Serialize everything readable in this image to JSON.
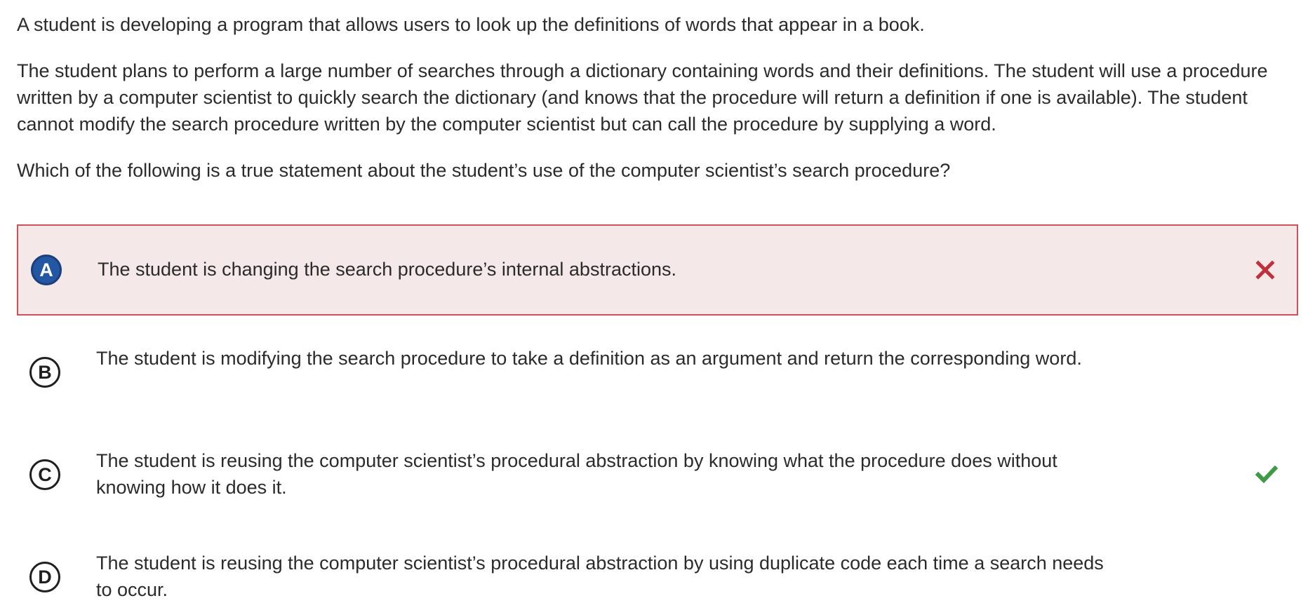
{
  "question": {
    "intro": "A student is developing a program that allows users to look up the definitions of words that appear in a book.",
    "context": "The student plans to perform a large number of searches through a dictionary containing words and their definitions. The student will use a procedure written by a computer scientist to quickly search the dictionary (and knows that the procedure will return a definition if one is available). The student cannot modify the search procedure written by the computer scientist but can call the procedure by supplying a word.",
    "prompt": "Which of the following is a true statement about the student’s use of the computer scientist’s search procedure?"
  },
  "choices": [
    {
      "letter": "A",
      "text": "The student is changing the search procedure’s internal abstractions.",
      "state": "selected-incorrect",
      "mark_icon": "x-icon"
    },
    {
      "letter": "B",
      "text": "The student is modifying the search procedure to take a definition as an argument and return the corresponding word.",
      "state": "unselected",
      "mark_icon": ""
    },
    {
      "letter": "C",
      "text": "The student is reusing the computer scientist’s procedural abstraction by knowing what the procedure does without knowing how it does it.",
      "state": "correct",
      "mark_icon": "check-icon"
    },
    {
      "letter": "D",
      "text": "The student is reusing the computer scientist’s procedural abstraction by using duplicate code each time a search needs to occur.",
      "state": "unselected",
      "mark_icon": ""
    }
  ],
  "colors": {
    "text": "#2b2b2b",
    "wrong_border": "#d0505c",
    "wrong_background": "#f4e8e8",
    "wrong_mark": "#c0303c",
    "correct_mark": "#3f9a45",
    "selected_badge": "#2457a3"
  }
}
